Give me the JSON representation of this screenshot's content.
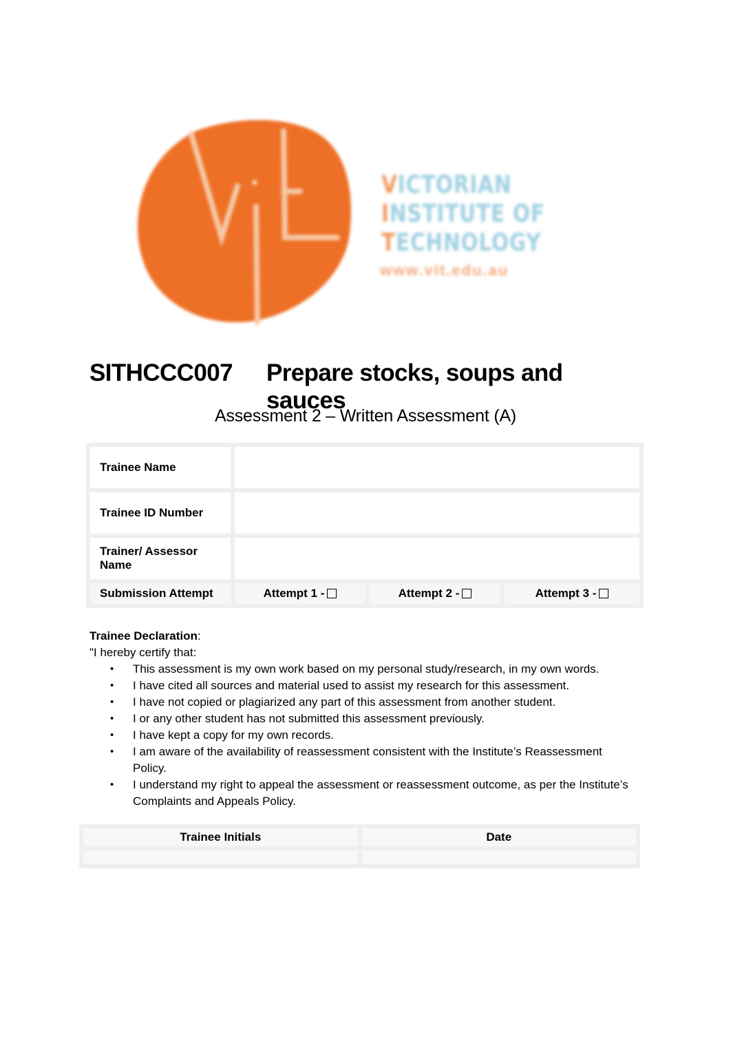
{
  "logo": {
    "monogram": "vit",
    "words": [
      "VICTORIAN",
      "INSTITUTE OF",
      "TECHNOLOGY"
    ],
    "url": "www.vit.edu.au",
    "colors": {
      "orange": "#ee7027",
      "blue": "#9fd0e2"
    }
  },
  "title": {
    "unit_code": "SITHCCC007",
    "unit_name": "Prepare stocks, soups and sauces",
    "assessment": "Assessment 2 – Written Assessment (A)"
  },
  "info_table": {
    "rows": [
      {
        "label": "Trainee Name",
        "value": ""
      },
      {
        "label": "Trainee ID Number",
        "value": ""
      },
      {
        "label": "Trainer/ Assessor Name",
        "value": ""
      }
    ],
    "submission": {
      "label": "Submission Attempt",
      "attempts": [
        {
          "label": "Attempt 1 -",
          "checked": false
        },
        {
          "label": "Attempt 2 -",
          "checked": false
        },
        {
          "label": "Attempt 3 -",
          "checked": false
        }
      ]
    }
  },
  "declaration": {
    "heading": "Trainee Declaration",
    "heading_suffix": ":",
    "intro": "\"I hereby certify that:",
    "bullet": "•",
    "items": [
      "This assessment is my own work based on my personal study/research, in my own words.",
      "I have cited all sources and material used to assist my research for this assessment.",
      "I have not copied or plagiarized any part of this assessment from another student.",
      "I or any other student has not submitted this assessment previously.",
      "I have kept a copy for my own records.",
      "I am aware of the availability of reassessment consistent with the Institute’s Reassessment Policy.",
      "I understand my right to appeal the assessment or reassessment outcome, as per the Institute’s Complaints and Appeals Policy."
    ]
  },
  "sign_table": {
    "headers": [
      "Trainee Initials",
      "Date"
    ],
    "values": [
      "",
      ""
    ]
  }
}
